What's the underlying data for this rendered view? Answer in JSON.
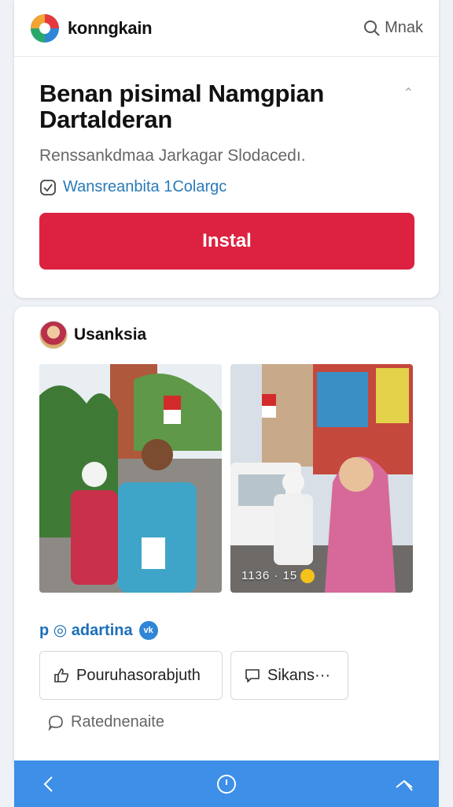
{
  "header": {
    "brand": "konngkain",
    "search_label": "Mnak"
  },
  "promo": {
    "title": "Benan pisimal Namgpian Dartalderan",
    "subtitle": "Renssankdmaa Jarkagar Slodacedı.",
    "verified_text": "Wansreanbita 1Colargc",
    "install_label": "Instal",
    "accent_color": "#dc2240"
  },
  "post": {
    "author": "Usanksia",
    "photo_caption": "1136 · 15",
    "source_text": "p ◎ adartina",
    "verified_badge": "vk",
    "like_label": "Pouruhasorabjuth",
    "share_label": "Sikans···",
    "comment_label": "Ratednenaite"
  },
  "bottom_nav": {
    "back_icon": "chevron-left-icon",
    "home_icon": "circle-home-icon",
    "menu_icon": "chevron-menu-icon",
    "color": "#3d8fe8"
  }
}
